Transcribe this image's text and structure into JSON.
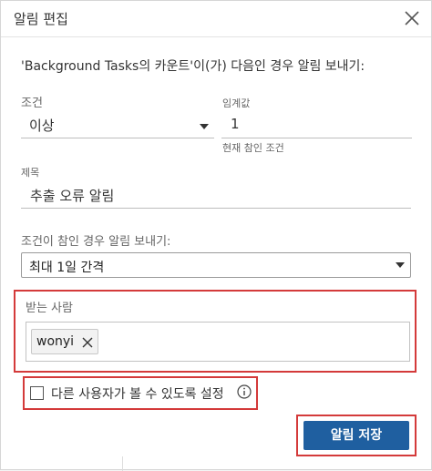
{
  "dialog": {
    "title": "알림 편집",
    "intro": "'Background Tasks의 카운트'이(가) 다음인 경우 알림 보내기:"
  },
  "condition": {
    "label": "조건",
    "value": "이상"
  },
  "threshold": {
    "label": "임계값",
    "value": "1",
    "hint": "현재 참인 조건"
  },
  "subject": {
    "label": "제목",
    "value": "추출 오류 알림"
  },
  "frequency": {
    "label": "조건이 참인 경우 알림 보내기:",
    "value": "최대 1일 간격"
  },
  "recipients": {
    "label": "받는 사람",
    "items": [
      {
        "name": "wonyi"
      }
    ]
  },
  "visibility": {
    "label": "다른 사용자가 볼 수 있도록 설정",
    "checked": false
  },
  "actions": {
    "save_label": "알림 저장"
  },
  "colors": {
    "primary_button": "#1f5fa0",
    "highlight_border": "#d43a3a"
  }
}
